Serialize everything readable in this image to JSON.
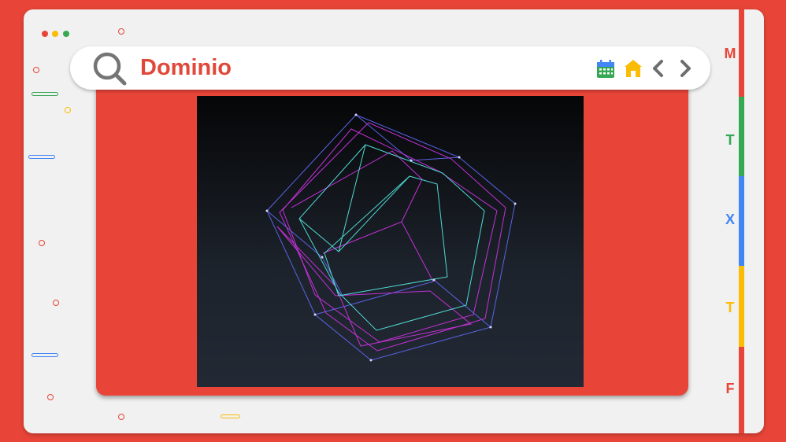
{
  "window": {
    "traffic_lights": [
      "#e84538",
      "#fbbc05",
      "#34a853"
    ]
  },
  "search": {
    "query": "Dominio"
  },
  "toolbar": {
    "icons": [
      "calendar-icon",
      "home-icon",
      "back-icon",
      "forward-icon"
    ]
  },
  "side_index": {
    "letters": [
      {
        "label": "M",
        "color": "#e84538"
      },
      {
        "label": "T",
        "color": "#34a853"
      },
      {
        "label": "X",
        "color": "#4285f4"
      },
      {
        "label": "T",
        "color": "#fbbc05"
      },
      {
        "label": "F",
        "color": "#e84538"
      }
    ]
  },
  "colors": {
    "brand_red": "#e84538",
    "green": "#34a853",
    "blue": "#4285f4",
    "yellow": "#fbbc05",
    "wire_magenta": "#c231d6",
    "wire_cyan": "#4fd9d3",
    "wire_blue": "#5a63e6"
  }
}
